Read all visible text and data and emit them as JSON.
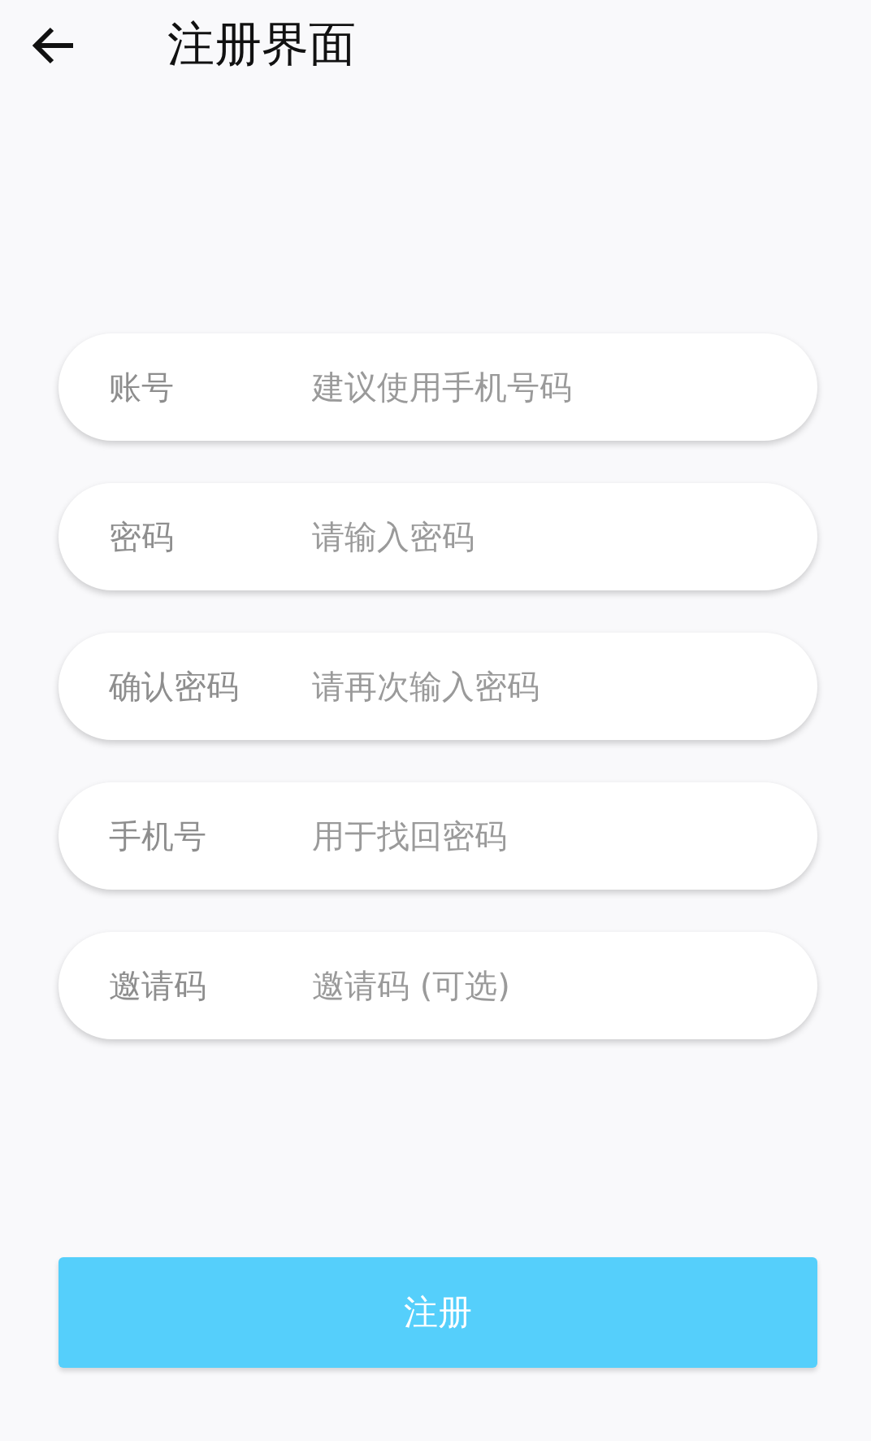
{
  "header": {
    "title": "注册界面"
  },
  "fields": [
    {
      "label": "账号",
      "placeholder": "建议使用手机号码"
    },
    {
      "label": "密码",
      "placeholder": "请输入密码"
    },
    {
      "label": "确认密码",
      "placeholder": "请再次输入密码"
    },
    {
      "label": "手机号",
      "placeholder": "用于找回密码"
    },
    {
      "label": "邀请码",
      "placeholder": "邀请码 (可选)"
    }
  ],
  "submit_button": "注册"
}
